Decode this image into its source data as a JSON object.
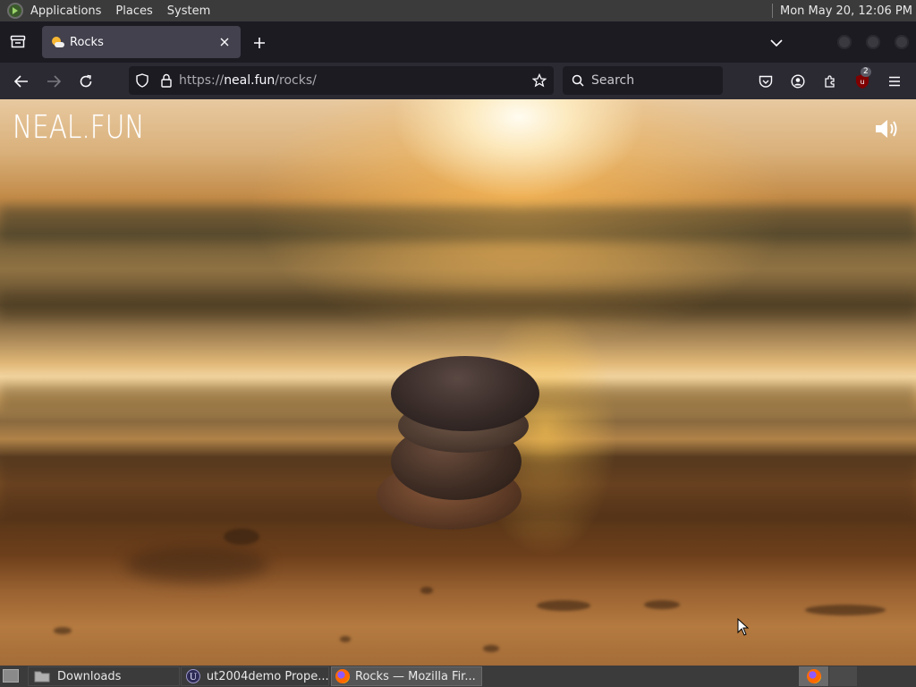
{
  "topbar": {
    "menus": [
      "Applications",
      "Places",
      "System"
    ],
    "clock": "Mon May 20, 12:06 PM"
  },
  "browser": {
    "tab": {
      "title": "Rocks"
    },
    "url": {
      "prefix": "https://",
      "host": "neal.fun",
      "path": "/rocks/"
    },
    "search_placeholder": "Search",
    "extension_badge": "2"
  },
  "page": {
    "logo": "NEAL.FUN",
    "sound_icon": "speaker-icon"
  },
  "taskbar": {
    "items": [
      {
        "label": "Downloads",
        "active": false
      },
      {
        "label": "ut2004demo Prope...",
        "active": false
      },
      {
        "label": "Rocks — Mozilla Fir...",
        "active": true
      }
    ]
  },
  "colors": {
    "firefox_dark": "#1c1b22",
    "toolbar": "#2b2a33",
    "tab_active": "#42414d",
    "panel": "#3b3b3b"
  }
}
